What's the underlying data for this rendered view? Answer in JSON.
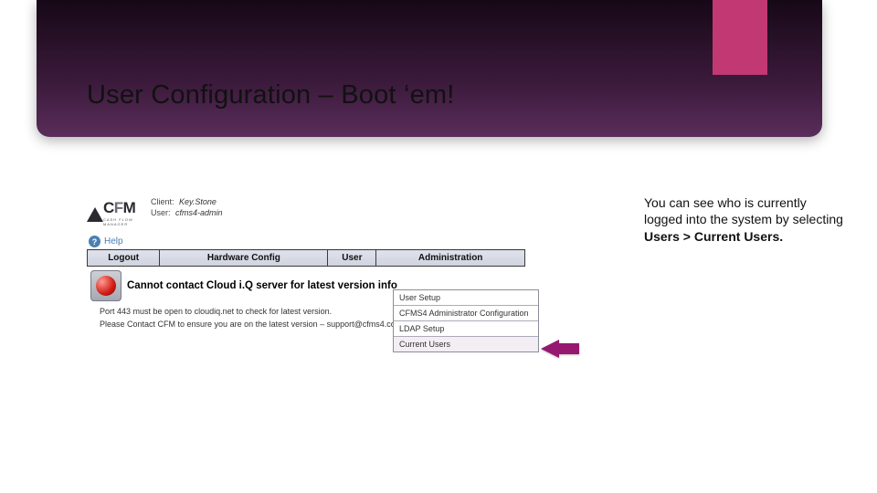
{
  "slide": {
    "title": "User Configuration – Boot ‘em!"
  },
  "caption": {
    "line1": "You can see who is currently logged into the system by selecting ",
    "bold": "Users > Current Users."
  },
  "app": {
    "logo_text": "CFM",
    "logo_sub": "CASH FLOW MANAGER",
    "client_label": "Client:",
    "client_value": "Key.Stone",
    "user_label": "User:",
    "user_value": "cfms4-admin",
    "help": "Help"
  },
  "nav": {
    "c0": "Logout",
    "c1": "Hardware Config",
    "c2": "User",
    "c3": "Administration"
  },
  "dropdown": {
    "i0": "User Setup",
    "i1": "CFMS4 Administrator Configuration",
    "i2": "LDAP Setup",
    "i3": "Current Users"
  },
  "status": {
    "main": "Cannot contact Cloud i.Q server for latest version info",
    "l1": "Port 443 must be open to cloudiq.net to check for latest version.",
    "l2": "Please Contact CFM to ensure you are on the latest version – support@cfms4.com."
  }
}
